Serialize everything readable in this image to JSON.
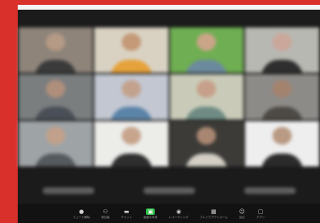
{
  "meeting": {
    "participants": [
      {
        "bg": "#8e847a",
        "skin": "#b59a85",
        "shirt": "#3b3b3b"
      },
      {
        "bg": "#d9d2c3",
        "skin": "#c49a78",
        "shirt": "#e6a23a"
      },
      {
        "bg": "#6fae52",
        "skin": "#caa588",
        "shirt": "#6c8a9e"
      },
      {
        "bg": "#b8b8b2",
        "skin": "#caa79a",
        "shirt": "#2e2e2e"
      },
      {
        "bg": "#7b7e7f",
        "skin": "#b08e7c",
        "shirt": "#4a4f57"
      },
      {
        "bg": "#c2c7d2",
        "skin": "#c3a28d",
        "shirt": "#5b84a8"
      },
      {
        "bg": "#c9cbb8",
        "skin": "#c6a08a",
        "shirt": "#6f8b84"
      },
      {
        "bg": "#8d8b88",
        "skin": "#a3836e",
        "shirt": "#4d4a45"
      },
      {
        "bg": "#9ea3a6",
        "skin": "#c1a18b",
        "shirt": "#555a5e"
      },
      {
        "bg": "#ecece9",
        "skin": "#c7a58d",
        "shirt": "#2f2f2f"
      },
      {
        "bg": "#3c3b37",
        "skin": "#a88672",
        "shirt": "#d3cfc5"
      },
      {
        "bg": "#eeeeee",
        "skin": "#b99a84",
        "shirt": "#2b2b2b"
      }
    ],
    "name_strip_count": 3
  },
  "toolbar": {
    "buttons": [
      {
        "icon": "mic-icon",
        "glyph": "●",
        "label": "ミュート解除"
      },
      {
        "icon": "participants-icon",
        "glyph": "⚇",
        "label": "参加者"
      },
      {
        "icon": "chat-icon",
        "glyph": "▬",
        "label": "チャット"
      },
      {
        "icon": "share-screen-icon",
        "glyph": "▣",
        "label": "画面の共有",
        "active": true
      },
      {
        "icon": "record-icon",
        "glyph": "◉",
        "label": "レコーディング"
      },
      {
        "icon": "breakout-rooms-icon",
        "glyph": "▦",
        "label": "ブレイクアウトルーム"
      },
      {
        "icon": "reactions-icon",
        "glyph": "☺",
        "label": "反応"
      },
      {
        "icon": "apps-icon",
        "glyph": "▢",
        "label": "アプリ"
      }
    ]
  }
}
